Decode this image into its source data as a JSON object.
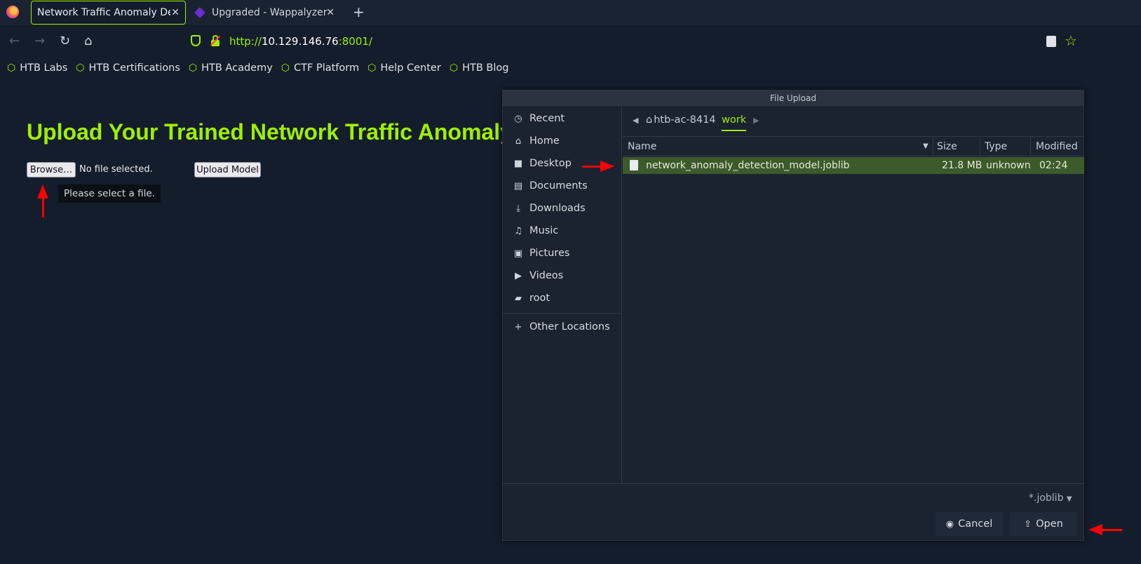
{
  "browser": {
    "tabs": [
      {
        "title": "Network Traffic Anomaly Det",
        "close": "✕"
      },
      {
        "title": "Upgraded - Wappalyzer",
        "close": "✕"
      }
    ],
    "new_tab": "+",
    "url_scheme": "http://",
    "url_host": "10.129.146.76",
    "url_rest": ":8001/",
    "bookmarks": [
      "HTB Labs",
      "HTB Certifications",
      "HTB Academy",
      "CTF Platform",
      "Help Center",
      "HTB Blog"
    ]
  },
  "page": {
    "title": "Upload Your Trained Network Traffic Anomaly Detection Model",
    "browse_label": "Browse…",
    "no_file_text": "No file selected.",
    "upload_label": "Upload Model",
    "tooltip": "Please select a file."
  },
  "dialog": {
    "title": "File Upload",
    "sidebar": [
      {
        "label": "Recent",
        "icon": "clock-icon"
      },
      {
        "label": "Home",
        "icon": "home-icon"
      },
      {
        "label": "Desktop",
        "icon": "desktop-icon"
      },
      {
        "label": "Documents",
        "icon": "document-icon"
      },
      {
        "label": "Downloads",
        "icon": "download-icon"
      },
      {
        "label": "Music",
        "icon": "music-icon"
      },
      {
        "label": "Pictures",
        "icon": "picture-icon"
      },
      {
        "label": "Videos",
        "icon": "video-icon"
      },
      {
        "label": "root",
        "icon": "folder-icon"
      }
    ],
    "other_locations": "Other Locations",
    "path": {
      "home": "htb-ac-8414",
      "current": "work"
    },
    "columns": {
      "name": "Name",
      "size": "Size",
      "type": "Type",
      "modified": "Modified"
    },
    "files": [
      {
        "name": "network_anomaly_detection_model.joblib",
        "size": "21.8 MB",
        "type": "unknown",
        "modified": "02:24"
      }
    ],
    "filter": "*.joblib",
    "cancel_label": "Cancel",
    "open_label": "Open"
  },
  "colors": {
    "accent": "#9fef00",
    "background": "#141d2b",
    "selection": "#3c5a2a",
    "annotation_arrow": "#ff0000"
  }
}
